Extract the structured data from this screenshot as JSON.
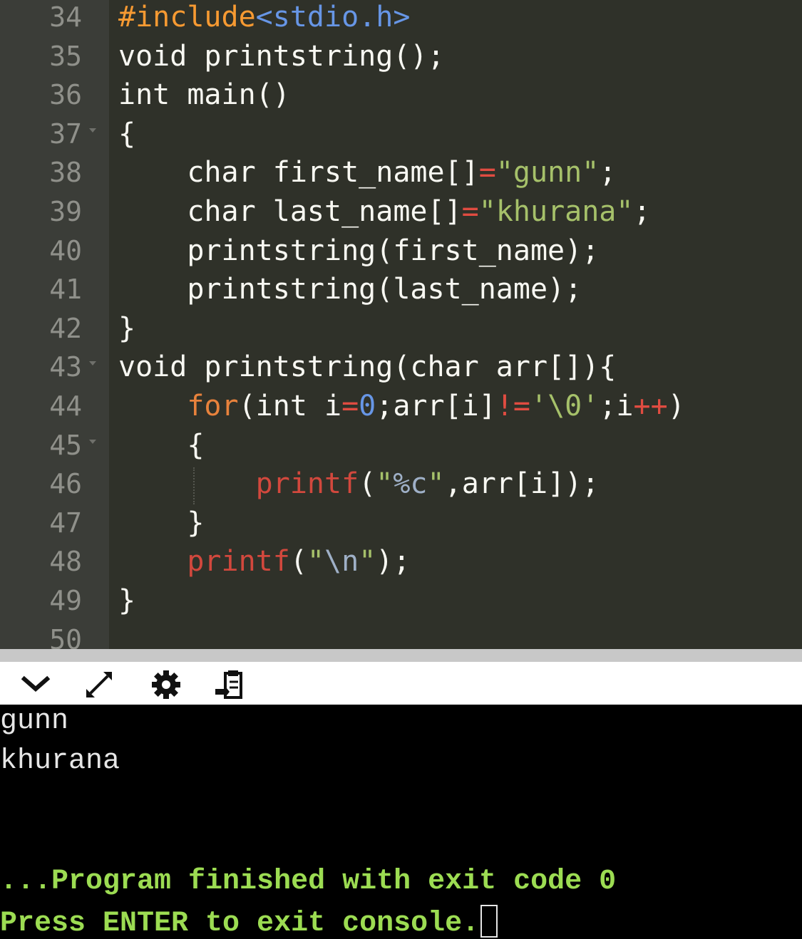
{
  "editor": {
    "lines": [
      {
        "number": "34",
        "fold": false,
        "tokens": [
          [
            "pre",
            "#include"
          ],
          [
            "inc",
            "<stdio.h>"
          ]
        ]
      },
      {
        "number": "35",
        "fold": false,
        "tokens": [
          [
            "pl",
            "void printstring();"
          ]
        ]
      },
      {
        "number": "36",
        "fold": false,
        "tokens": [
          [
            "pl",
            "int main()"
          ]
        ]
      },
      {
        "number": "37",
        "fold": true,
        "tokens": [
          [
            "pl",
            "{"
          ]
        ]
      },
      {
        "number": "38",
        "fold": false,
        "tokens": [
          [
            "pl",
            "    char first_name[]"
          ],
          [
            "op",
            "="
          ],
          [
            "str",
            "\"gunn\""
          ],
          [
            "pl",
            ";"
          ]
        ]
      },
      {
        "number": "39",
        "fold": false,
        "tokens": [
          [
            "pl",
            "    char last_name[]"
          ],
          [
            "op",
            "="
          ],
          [
            "str",
            "\"khurana\""
          ],
          [
            "pl",
            ";"
          ]
        ]
      },
      {
        "number": "40",
        "fold": false,
        "tokens": [
          [
            "pl",
            "    printstring(first_name);"
          ]
        ]
      },
      {
        "number": "41",
        "fold": false,
        "tokens": [
          [
            "pl",
            "    printstring(last_name);"
          ]
        ]
      },
      {
        "number": "42",
        "fold": false,
        "tokens": [
          [
            "pl",
            "}"
          ]
        ]
      },
      {
        "number": "43",
        "fold": true,
        "tokens": [
          [
            "pl",
            "void printstring(char arr[]){"
          ]
        ]
      },
      {
        "number": "44",
        "fold": false,
        "tokens": [
          [
            "pl",
            "    "
          ],
          [
            "kw",
            "for"
          ],
          [
            "pl",
            "(int i"
          ],
          [
            "op",
            "="
          ],
          [
            "num",
            "0"
          ],
          [
            "pl",
            ";arr[i]"
          ],
          [
            "op",
            "!="
          ],
          [
            "str",
            "'\\0'"
          ],
          [
            "pl",
            ";i"
          ],
          [
            "op",
            "++"
          ],
          [
            "pl",
            ")"
          ]
        ]
      },
      {
        "number": "45",
        "fold": true,
        "tokens": [
          [
            "pl",
            "    {"
          ]
        ]
      },
      {
        "number": "46",
        "fold": false,
        "tokens": [
          [
            "pl",
            "        "
          ],
          [
            "fn",
            "printf"
          ],
          [
            "pl",
            "("
          ],
          [
            "str",
            "\""
          ],
          [
            "fmt",
            "%c"
          ],
          [
            "str",
            "\""
          ],
          [
            "pl",
            ",arr[i]);"
          ]
        ]
      },
      {
        "number": "47",
        "fold": false,
        "tokens": [
          [
            "pl",
            "    }"
          ]
        ]
      },
      {
        "number": "48",
        "fold": false,
        "tokens": [
          [
            "pl",
            "    "
          ],
          [
            "fn",
            "printf"
          ],
          [
            "pl",
            "("
          ],
          [
            "str",
            "\""
          ],
          [
            "fmt",
            "\\n"
          ],
          [
            "str",
            "\""
          ],
          [
            "pl",
            ");"
          ]
        ]
      },
      {
        "number": "49",
        "fold": false,
        "tokens": [
          [
            "pl",
            "}"
          ]
        ]
      },
      {
        "number": "50",
        "fold": false,
        "tokens": []
      }
    ]
  },
  "toolbar": {
    "icons": [
      "chevron-down-icon",
      "expand-icon",
      "gear-icon",
      "paste-icon"
    ]
  },
  "console": {
    "output_lines": [
      "gunn",
      "khurana"
    ],
    "status_line": "...Program finished with exit code 0",
    "prompt_line": "Press ENTER to exit console."
  },
  "colors": {
    "editor_bg": "#2f3129",
    "gutter_bg": "#3b3d38",
    "console_bg": "#000000",
    "status_green": "#9cdc52",
    "keyword_orange": "#e8823c",
    "string_green": "#a6c16a",
    "function_red": "#d2483d"
  }
}
